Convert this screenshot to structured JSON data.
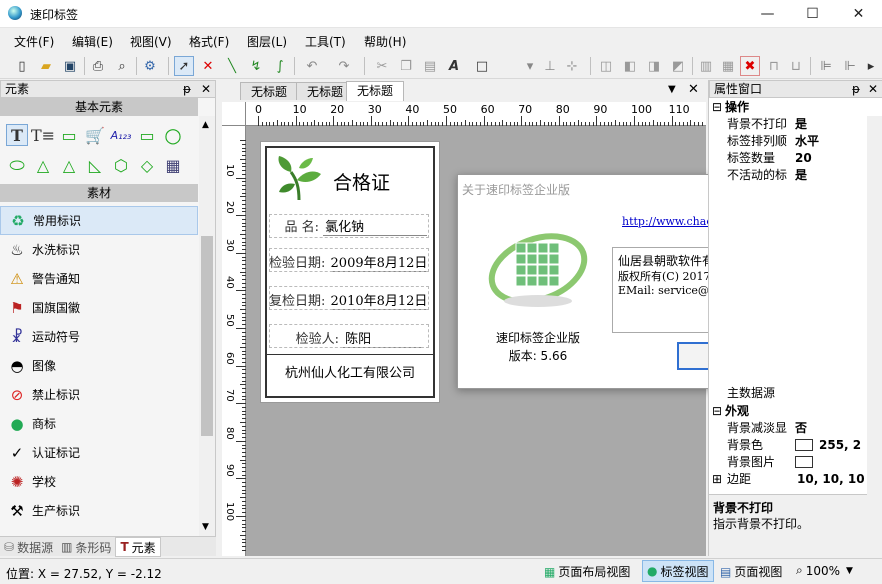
{
  "window": {
    "title": "速印标签",
    "min": "—",
    "max": "☐",
    "close": "✕"
  },
  "menu": [
    {
      "label": "文件(F)"
    },
    {
      "label": "编辑(E)"
    },
    {
      "label": "视图(V)"
    },
    {
      "label": "格式(F)"
    },
    {
      "label": "图层(L)"
    },
    {
      "label": "工具(T)"
    },
    {
      "label": "帮助(H)"
    }
  ],
  "left_panel": {
    "title": "元素",
    "pin": "ᵽ",
    "close": "✕",
    "basic_header": "基本元素",
    "material_header": "素材",
    "materials": [
      {
        "label": "常用标识",
        "icon": "recycle-icon"
      },
      {
        "label": "水洗标识",
        "icon": "laundry-icon"
      },
      {
        "label": "警告通知",
        "icon": "warning-icon"
      },
      {
        "label": "国旗国徽",
        "icon": "flag-icon"
      },
      {
        "label": "运动符号",
        "icon": "sports-icon"
      },
      {
        "label": "图像",
        "icon": "image-icon"
      },
      {
        "label": "禁止标识",
        "icon": "prohibit-icon"
      },
      {
        "label": "商标",
        "icon": "logo-icon"
      },
      {
        "label": "认证标记",
        "icon": "cert-icon"
      },
      {
        "label": "学校",
        "icon": "school-icon"
      },
      {
        "label": "生产标识",
        "icon": "production-icon"
      }
    ],
    "bottom_tabs": [
      {
        "label": "数据源"
      },
      {
        "label": "条形码"
      },
      {
        "label": "元素"
      }
    ]
  },
  "doc_tabs": [
    {
      "label": "无标题"
    },
    {
      "label": "无标题"
    },
    {
      "label": "无标题"
    }
  ],
  "ruler_h": [
    "0",
    "10",
    "20",
    "30",
    "40",
    "50",
    "60",
    "70",
    "80",
    "90",
    "100",
    "110"
  ],
  "ruler_v": [
    "10",
    "20",
    "30",
    "40",
    "50",
    "60",
    "70",
    "80",
    "90",
    "100"
  ],
  "label": {
    "title": "合格证",
    "name_label": "品 名:",
    "name_value": "氯化钠",
    "inspect_date_label": "检验日期:",
    "inspect_date_value": "2009年8月12日",
    "recheck_date_label": "复检日期:",
    "recheck_date_value": "2010年8月12日",
    "inspector_label": "检验人:",
    "inspector_value": "陈阳",
    "company": "杭州仙人化工有限公司"
  },
  "about_dialog": {
    "title": "关于速印标签企业版",
    "close": "✕",
    "link": "http://www.chaogesoft.com",
    "product_name": "速印标签企业版",
    "version": "版本: 5.66",
    "info_line1": "仙居县朝歌软件有限公司",
    "info_line2": "版权所有(C) 2017-2025",
    "info_line3": "EMail: service@chaogesoft.com",
    "ok_button": "确定(O)"
  },
  "props_panel": {
    "title": "属性窗口",
    "groups": [
      {
        "name": "操作",
        "rows": [
          {
            "key": "背景不打印",
            "value": "是"
          },
          {
            "key": "标签排列顺",
            "value": "水平"
          },
          {
            "key": "标签数量",
            "value": "20"
          },
          {
            "key": "不活动的标",
            "value": "是"
          }
        ]
      },
      {
        "name": "外观",
        "rows": [
          {
            "key": "背景减淡显",
            "value": "否"
          },
          {
            "key": "背景色",
            "value": "255, 2"
          },
          {
            "key": "背景图片",
            "value": ""
          },
          {
            "key": "边距",
            "value": "10, 10, 10"
          }
        ]
      }
    ],
    "extra_row": "主数据源",
    "desc_title": "背景不打印",
    "desc_text": "指示背景不打印。"
  },
  "status": {
    "position": "位置: X = 27.52, Y = -2.12",
    "page_layout_view": "页面布局视图",
    "label_view": "标签视图",
    "page_view": "页面视图",
    "zoom": "100%"
  }
}
